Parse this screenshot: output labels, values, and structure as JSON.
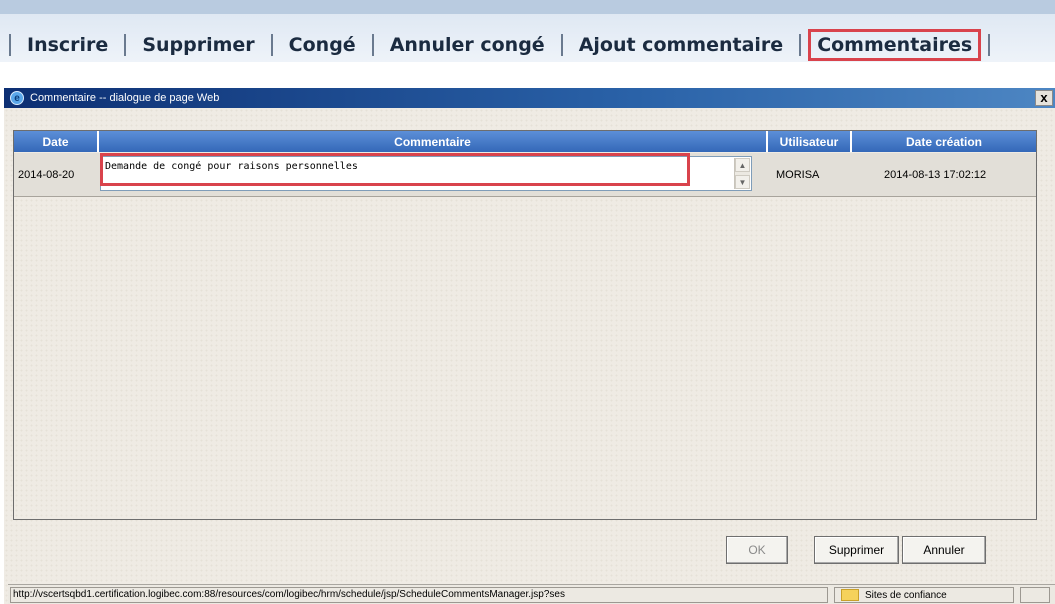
{
  "toolbar": {
    "items": [
      "Inscrire",
      "Supprimer",
      "Congé",
      "Annuler congé",
      "Ajout commentaire",
      "Commentaires"
    ],
    "active": "Commentaires"
  },
  "dialog": {
    "title": "Commentaire -- dialogue de page Web",
    "close_label": "x",
    "columns": {
      "date": "Date",
      "comment": "Commentaire",
      "user": "Utilisateur",
      "created": "Date création"
    },
    "rows": [
      {
        "date": "2014-08-20",
        "comment": "Demande de congé pour raisons personnelles",
        "user": "MORISA",
        "created": "2014-08-13 17:02:12"
      }
    ],
    "buttons": {
      "ok": "OK",
      "delete": "Supprimer",
      "cancel": "Annuler"
    },
    "status": {
      "url": "http://vscertsqbd1.certification.logibec.com:88/resources/com/logibec/hrm/schedule/jsp/ScheduleCommentsManager.jsp?ses",
      "zone": "Sites de confiance"
    }
  },
  "colors": {
    "highlight": "#d9434c",
    "header_blue": "#3468b8",
    "titlebar": "#0d2f73"
  }
}
